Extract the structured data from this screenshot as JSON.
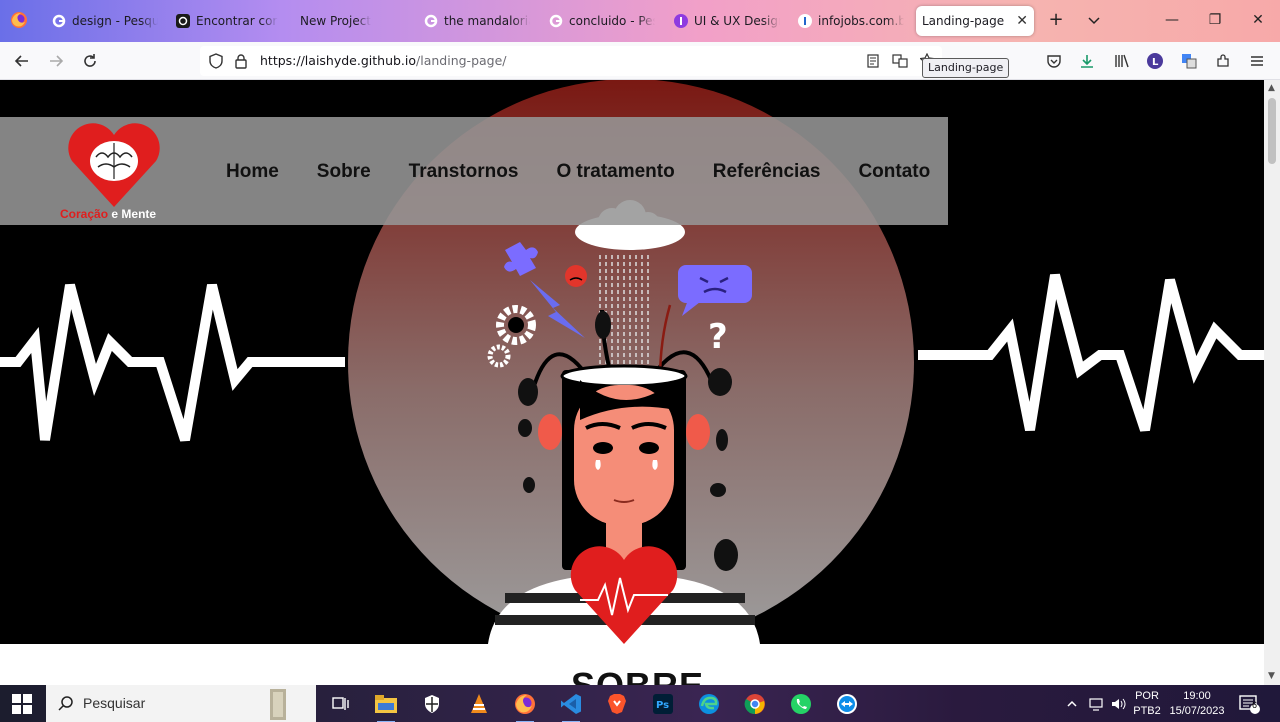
{
  "browser": {
    "tabs": [
      {
        "title": "design - Pesquisa Google",
        "favicon": "google-g"
      },
      {
        "title": "Encontrar cor por código",
        "favicon": "colorpicker"
      },
      {
        "title": "New Project",
        "favicon": "none"
      },
      {
        "title": "the mandalorian - Pesquisa",
        "favicon": "google-g"
      },
      {
        "title": "concluido - Pesquisa Google",
        "favicon": "google-g"
      },
      {
        "title": "UI & UX Design com",
        "favicon": "ui-ux"
      },
      {
        "title": "infojobs.com.br/",
        "favicon": "infojobs"
      },
      {
        "title": "Landing-page",
        "favicon": "none",
        "active": true
      }
    ],
    "url_host": "https://laishyde.github.io",
    "url_path": "/landing-page/",
    "tooltip": "Landing-page"
  },
  "site": {
    "logo": {
      "word1": "Coração",
      "conj": "e",
      "word2": "Mente"
    },
    "menu": [
      "Home",
      "Sobre",
      "Transtornos",
      "O tratamento",
      "Referências",
      "Contato"
    ],
    "section_title": "SOBRE"
  },
  "taskbar": {
    "search_placeholder": "Pesquisar",
    "lang_top": "POR",
    "lang_bottom": "PTB2",
    "time": "19:00",
    "date": "15/07/2023",
    "notifications": "6"
  },
  "colors": {
    "accent_red": "#e01e1e",
    "header_gray": "#969696",
    "hero_bg": "#000000"
  }
}
